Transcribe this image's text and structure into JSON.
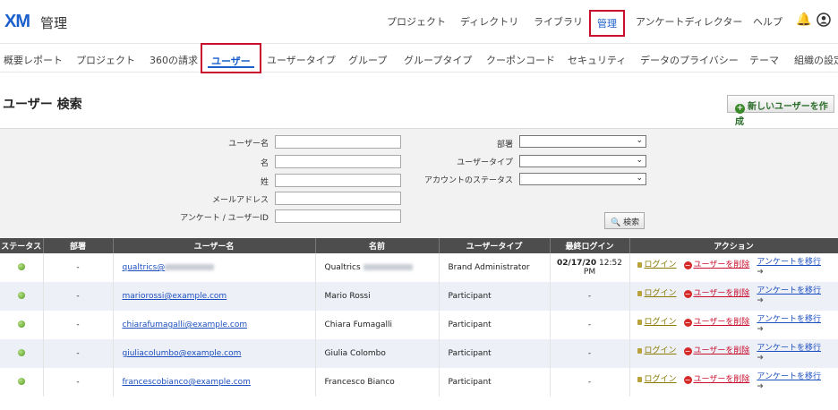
{
  "app": {
    "logo": "XM",
    "title": "管理"
  },
  "topnav": {
    "items": [
      "プロジェクト",
      "ディレクトリ",
      "ライブラリ",
      "管理",
      "アンケートディレクター",
      "ヘルプ"
    ],
    "active": "管理",
    "icons": [
      "bell-icon",
      "user-account-icon"
    ]
  },
  "subnav": {
    "items": [
      "概要レポート",
      "プロジェクト",
      "360の請求",
      "ユーザー",
      "ユーザータイプ",
      "グループ",
      "グループタイプ",
      "クーポンコード",
      "セキュリティ",
      "データのプライバシー",
      "テーマ",
      "組織の設定"
    ],
    "active": "ユーザー"
  },
  "page": {
    "title": "ユーザー 検索",
    "create_button": "新しいユーザーを作成"
  },
  "search": {
    "username_label": "ユーザー名",
    "first_name_label": "名",
    "last_name_label": "姓",
    "email_label": "メールアドレス",
    "survey_user_id_label": "アンケート / ユーザーID",
    "division_label": "部署",
    "user_type_label": "ユーザータイプ",
    "account_status_label": "アカウントのステータス",
    "search_button": "検索"
  },
  "table": {
    "headers": [
      "ステータス",
      "部署",
      "ユーザー名",
      "名前",
      "ユーザータイプ",
      "最終ログイン",
      "アクション"
    ],
    "rows": [
      {
        "division": "-",
        "username": "qualtrics@",
        "name": "Qualtrics",
        "user_type": "Brand Administrator",
        "last_login_date": "02/17/20",
        "last_login_time": " 12:52 PM"
      },
      {
        "division": "-",
        "username": "mariorossi@example.com",
        "name": "Mario Rossi",
        "user_type": "Participant",
        "last_login_date": "-",
        "last_login_time": ""
      },
      {
        "division": "-",
        "username": "chiarafumagalli@example.com",
        "name": "Chiara Fumagalli",
        "user_type": "Participant",
        "last_login_date": "-",
        "last_login_time": ""
      },
      {
        "division": "-",
        "username": "giuliacolumbo@example.com",
        "name": "Giulia Colombo",
        "user_type": "Participant",
        "last_login_date": "-",
        "last_login_time": ""
      },
      {
        "division": "-",
        "username": "francescobianco@example.com",
        "name": "Francesco Bianco",
        "user_type": "Participant",
        "last_login_date": "-",
        "last_login_time": ""
      }
    ],
    "actions": {
      "login": "ログイン",
      "delete": "ユーザーを削除",
      "move": "アンケートを移行"
    }
  },
  "colors": {
    "highlight": "#c8102e",
    "brand": "#1b5fcc",
    "header_bg": "#4d4d4d",
    "status_active": "#4f9a1c"
  }
}
